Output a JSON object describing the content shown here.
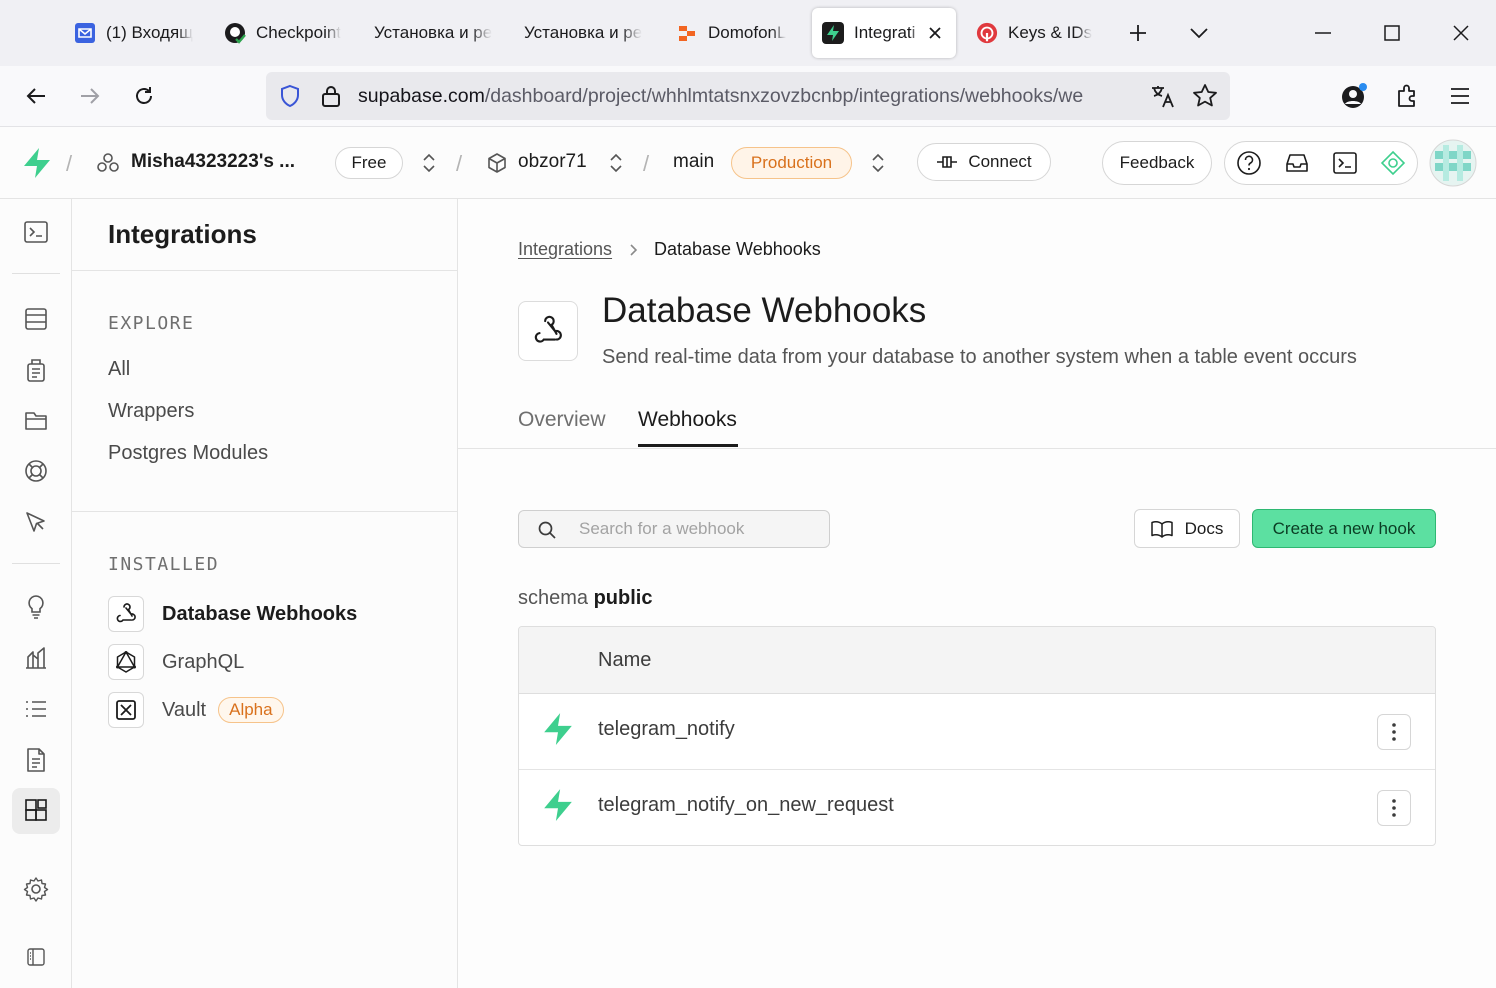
{
  "browser": {
    "tabs": [
      {
        "title": "(1) Входящ",
        "icon": "mail-icon"
      },
      {
        "title": "Checkpoint",
        "icon": "github-icon"
      },
      {
        "title": "Установка и ре",
        "icon": "none"
      },
      {
        "title": "Установка и ре",
        "icon": "none"
      },
      {
        "title": "DomofonL",
        "icon": "domofon-icon"
      },
      {
        "title": "Integrati",
        "icon": "supabase-icon"
      },
      {
        "title": "Keys & IDs",
        "icon": "keys-icon"
      }
    ],
    "url_host": "supabase.com",
    "url_path": "/dashboard/project/whhlmtatsnxzovzbcnbp/integrations/webhooks/we"
  },
  "header": {
    "org_name": "Misha4323223's ...",
    "plan_badge": "Free",
    "project_name": "obzor71",
    "branch_name": "main",
    "env_badge": "Production",
    "connect_label": "Connect",
    "feedback_label": "Feedback"
  },
  "sidebar": {
    "title": "Integrations",
    "explore_heading": "EXPLORE",
    "explore_items": [
      "All",
      "Wrappers",
      "Postgres Modules"
    ],
    "installed_heading": "INSTALLED",
    "installed_items": [
      {
        "label": "Database Webhooks",
        "icon": "webhook-icon"
      },
      {
        "label": "GraphQL",
        "icon": "graphql-icon"
      },
      {
        "label": "Vault",
        "icon": "vault-icon",
        "badge": "Alpha"
      }
    ]
  },
  "main": {
    "breadcrumb_parent": "Integrations",
    "breadcrumb_current": "Database Webhooks",
    "title": "Database Webhooks",
    "subtitle": "Send real-time data from your database to another system when a table event occurs",
    "tabs": [
      "Overview",
      "Webhooks"
    ],
    "active_tab": "Webhooks",
    "search_placeholder": "Search for a webhook",
    "docs_label": "Docs",
    "create_label": "Create a new hook",
    "schema_prefix": "schema",
    "schema_name": "public",
    "table_header": "Name",
    "rows": [
      {
        "name": "telegram_notify"
      },
      {
        "name": "telegram_notify_on_new_request"
      }
    ]
  },
  "colors": {
    "brand_green": "#3ecf8e",
    "create_button_bg": "#5ce0a1",
    "production_badge": "#f5a04a"
  }
}
